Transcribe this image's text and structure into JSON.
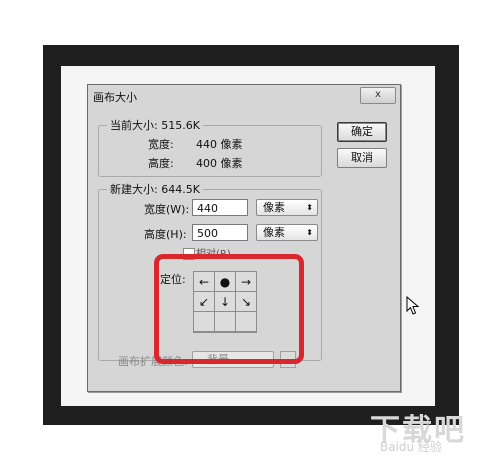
{
  "dialog": {
    "title": "画布大小",
    "close_label": "x",
    "current": {
      "legend": "当前大小: 515.6K",
      "width_label": "宽度:",
      "width_value": "440 像素",
      "height_label": "高度:",
      "height_value": "400 像素"
    },
    "new": {
      "legend": "新建大小: 644.5K",
      "width_label": "宽度(W):",
      "width_value": "440",
      "width_unit": "像素",
      "height_label": "高度(H):",
      "height_value": "500",
      "height_unit": "像素",
      "relative_label": "相对(R)",
      "anchor_label": "定位:",
      "anchor_cells": [
        "←",
        "●",
        "→",
        "↙",
        "↓",
        "↘",
        "",
        "",
        ""
      ]
    },
    "extension_label": "画布扩展颜色:",
    "extension_value": "背景",
    "ok_label": "确定",
    "cancel_label": "取消"
  },
  "watermark": {
    "main": "下载吧",
    "sub": "Baidu 经验"
  },
  "colors": {
    "highlight": "#d8282e",
    "frame": "#1f1f1f",
    "dialog_bg": "#d6d6d6"
  }
}
